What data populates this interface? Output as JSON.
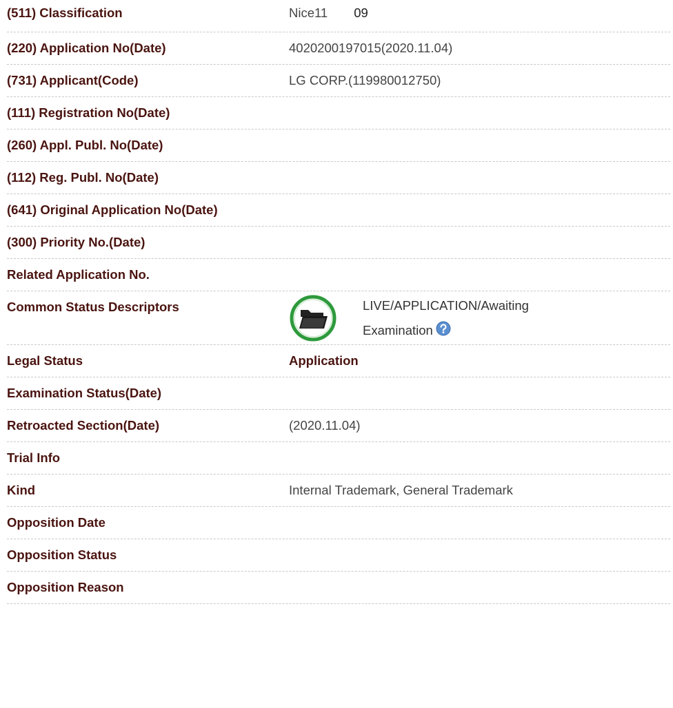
{
  "rows": [
    {
      "label": "(511) Classification",
      "value": "Nice11",
      "extra": "09"
    },
    {
      "label": "(220) Application No(Date)",
      "value": "4020200197015(2020.11.04)"
    },
    {
      "label": "(731) Applicant(Code)",
      "value": "LG CORP.(119980012750)"
    },
    {
      "label": "(111) Registration No(Date)",
      "value": ""
    },
    {
      "label": "(260) Appl. Publ. No(Date)",
      "value": ""
    },
    {
      "label": "(112) Reg. Publ. No(Date)",
      "value": ""
    },
    {
      "label": "(641) Original Application No(Date)",
      "value": ""
    },
    {
      "label": "(300) Priority No.(Date)",
      "value": ""
    },
    {
      "label": "Related Application No.",
      "value": ""
    },
    {
      "label": "Common Status Descriptors",
      "value": "LIVE/APPLICATION/Awaiting Examination",
      "icon": "folder-status-icon",
      "help_icon": "help-icon"
    },
    {
      "label": "Legal Status",
      "value": "Application"
    },
    {
      "label": "Examination Status(Date)",
      "value": ""
    },
    {
      "label": "Retroacted Section(Date)",
      "value": "(2020.11.04)"
    },
    {
      "label": "Trial Info",
      "value": ""
    },
    {
      "label": "Kind",
      "value": "Internal Trademark, General Trademark"
    },
    {
      "label": "Opposition Date",
      "value": ""
    },
    {
      "label": "Opposition Status",
      "value": ""
    },
    {
      "label": "Opposition Reason",
      "value": ""
    }
  ],
  "colors": {
    "label": "#4a1410",
    "value": "#444444",
    "divider": "#c8c8c8",
    "status_ring": "#2e9a3c",
    "help": "#5a8fd0"
  }
}
